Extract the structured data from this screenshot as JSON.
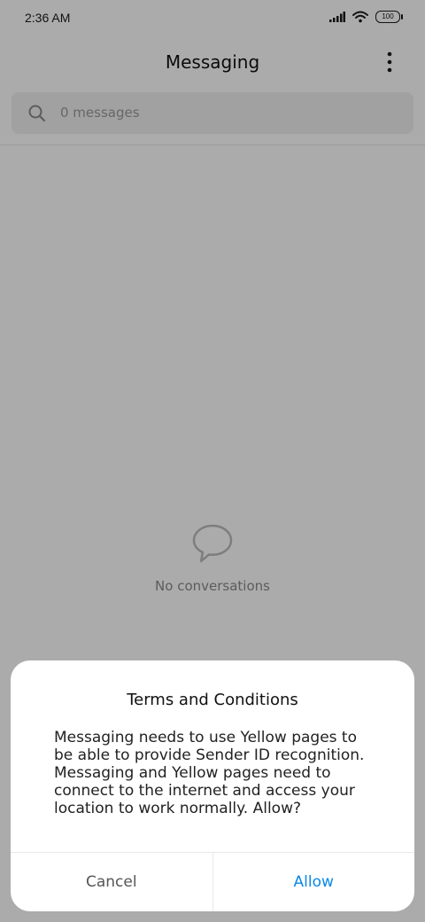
{
  "status_bar": {
    "time": "2:36 AM",
    "battery": "100",
    "icons": [
      "signal-icon",
      "wifi-icon",
      "battery-icon"
    ]
  },
  "header": {
    "title": "Messaging",
    "menu_icon": "more-vertical-icon"
  },
  "search": {
    "placeholder": "0 messages",
    "icon": "search-icon"
  },
  "empty_state": {
    "icon": "chat-bubble-icon",
    "text": "No conversations"
  },
  "dialog": {
    "title": "Terms and Conditions",
    "message": "Messaging needs to use Yellow pages to be able to provide Sender ID recognition. Messaging and Yellow pages need to connect to the internet and access your location to work normally. Allow?",
    "cancel_label": "Cancel",
    "allow_label": "Allow"
  },
  "colors": {
    "accent": "#0a88e8",
    "overlay": "#000000"
  }
}
